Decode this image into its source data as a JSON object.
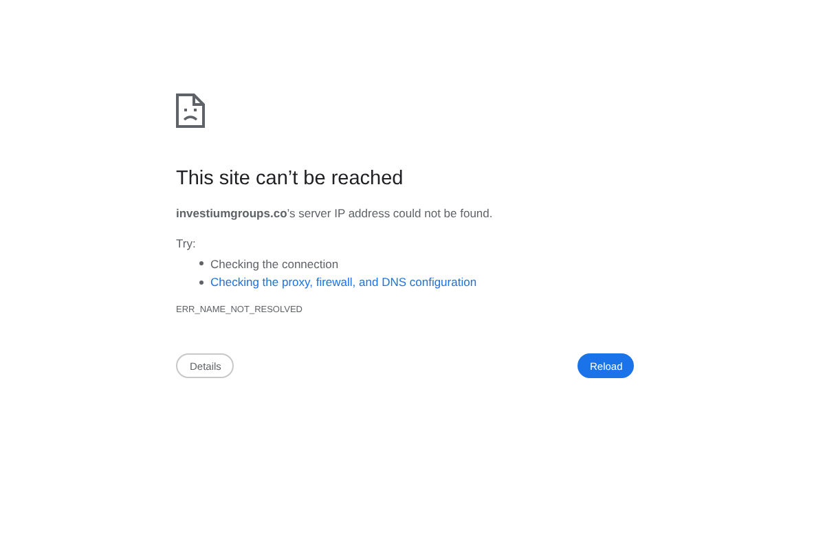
{
  "title": "This site can’t be reached",
  "message": "**investiumgroups.co**’s server IP address could not be found.",
  "try_label": "Try:",
  "suggestions": [
    {
      "kind": "text",
      "text": "Checking the connection"
    },
    {
      "kind": "link",
      "text": "Checking the proxy, firewall, and DNS configuration"
    }
  ],
  "error_code": "ERR_NAME_NOT_RESOLVED",
  "buttons": {
    "details": "Details",
    "reload": "Reload"
  }
}
